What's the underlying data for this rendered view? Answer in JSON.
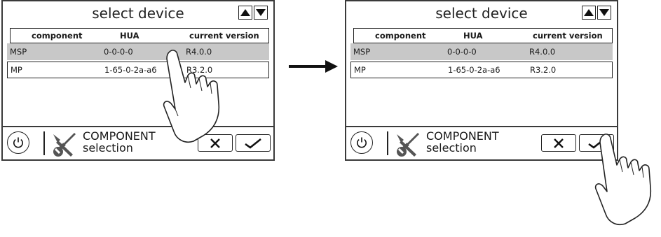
{
  "screens": [
    {
      "title": "select device",
      "columns": [
        "component",
        "HUA",
        "current version"
      ],
      "rows": [
        {
          "component": "MSP",
          "hua": "0-0-0-0",
          "version": "R4.0.0",
          "selected": true
        },
        {
          "component": "MP",
          "hua": "1-65-0-2a-a6",
          "version": "R3.2.0",
          "selected": false
        }
      ],
      "bottom_title_line1": "COMPONENT",
      "bottom_title_line2": "selection"
    },
    {
      "title": "select device",
      "columns": [
        "component",
        "HUA",
        "current version"
      ],
      "rows": [
        {
          "component": "MSP",
          "hua": "0-0-0-0",
          "version": "R4.0.0",
          "selected": true
        },
        {
          "component": "MP",
          "hua": "1-65-0-2a-a6",
          "version": "R3.2.0",
          "selected": false
        }
      ],
      "bottom_title_line1": "COMPONENT",
      "bottom_title_line2": "selection"
    }
  ],
  "icons": {
    "scroll_up": "triangle-up-icon",
    "scroll_down": "triangle-down-icon",
    "power": "power-icon",
    "tools": "wrench-screwdriver-icon",
    "cancel": "x-icon",
    "confirm": "checkmark-icon",
    "transition": "right-arrow-icon",
    "pointer": "hand-pointer-icon"
  },
  "colors": {
    "selected_row": "#c8c8c8",
    "frame": "#3a3a3a"
  }
}
